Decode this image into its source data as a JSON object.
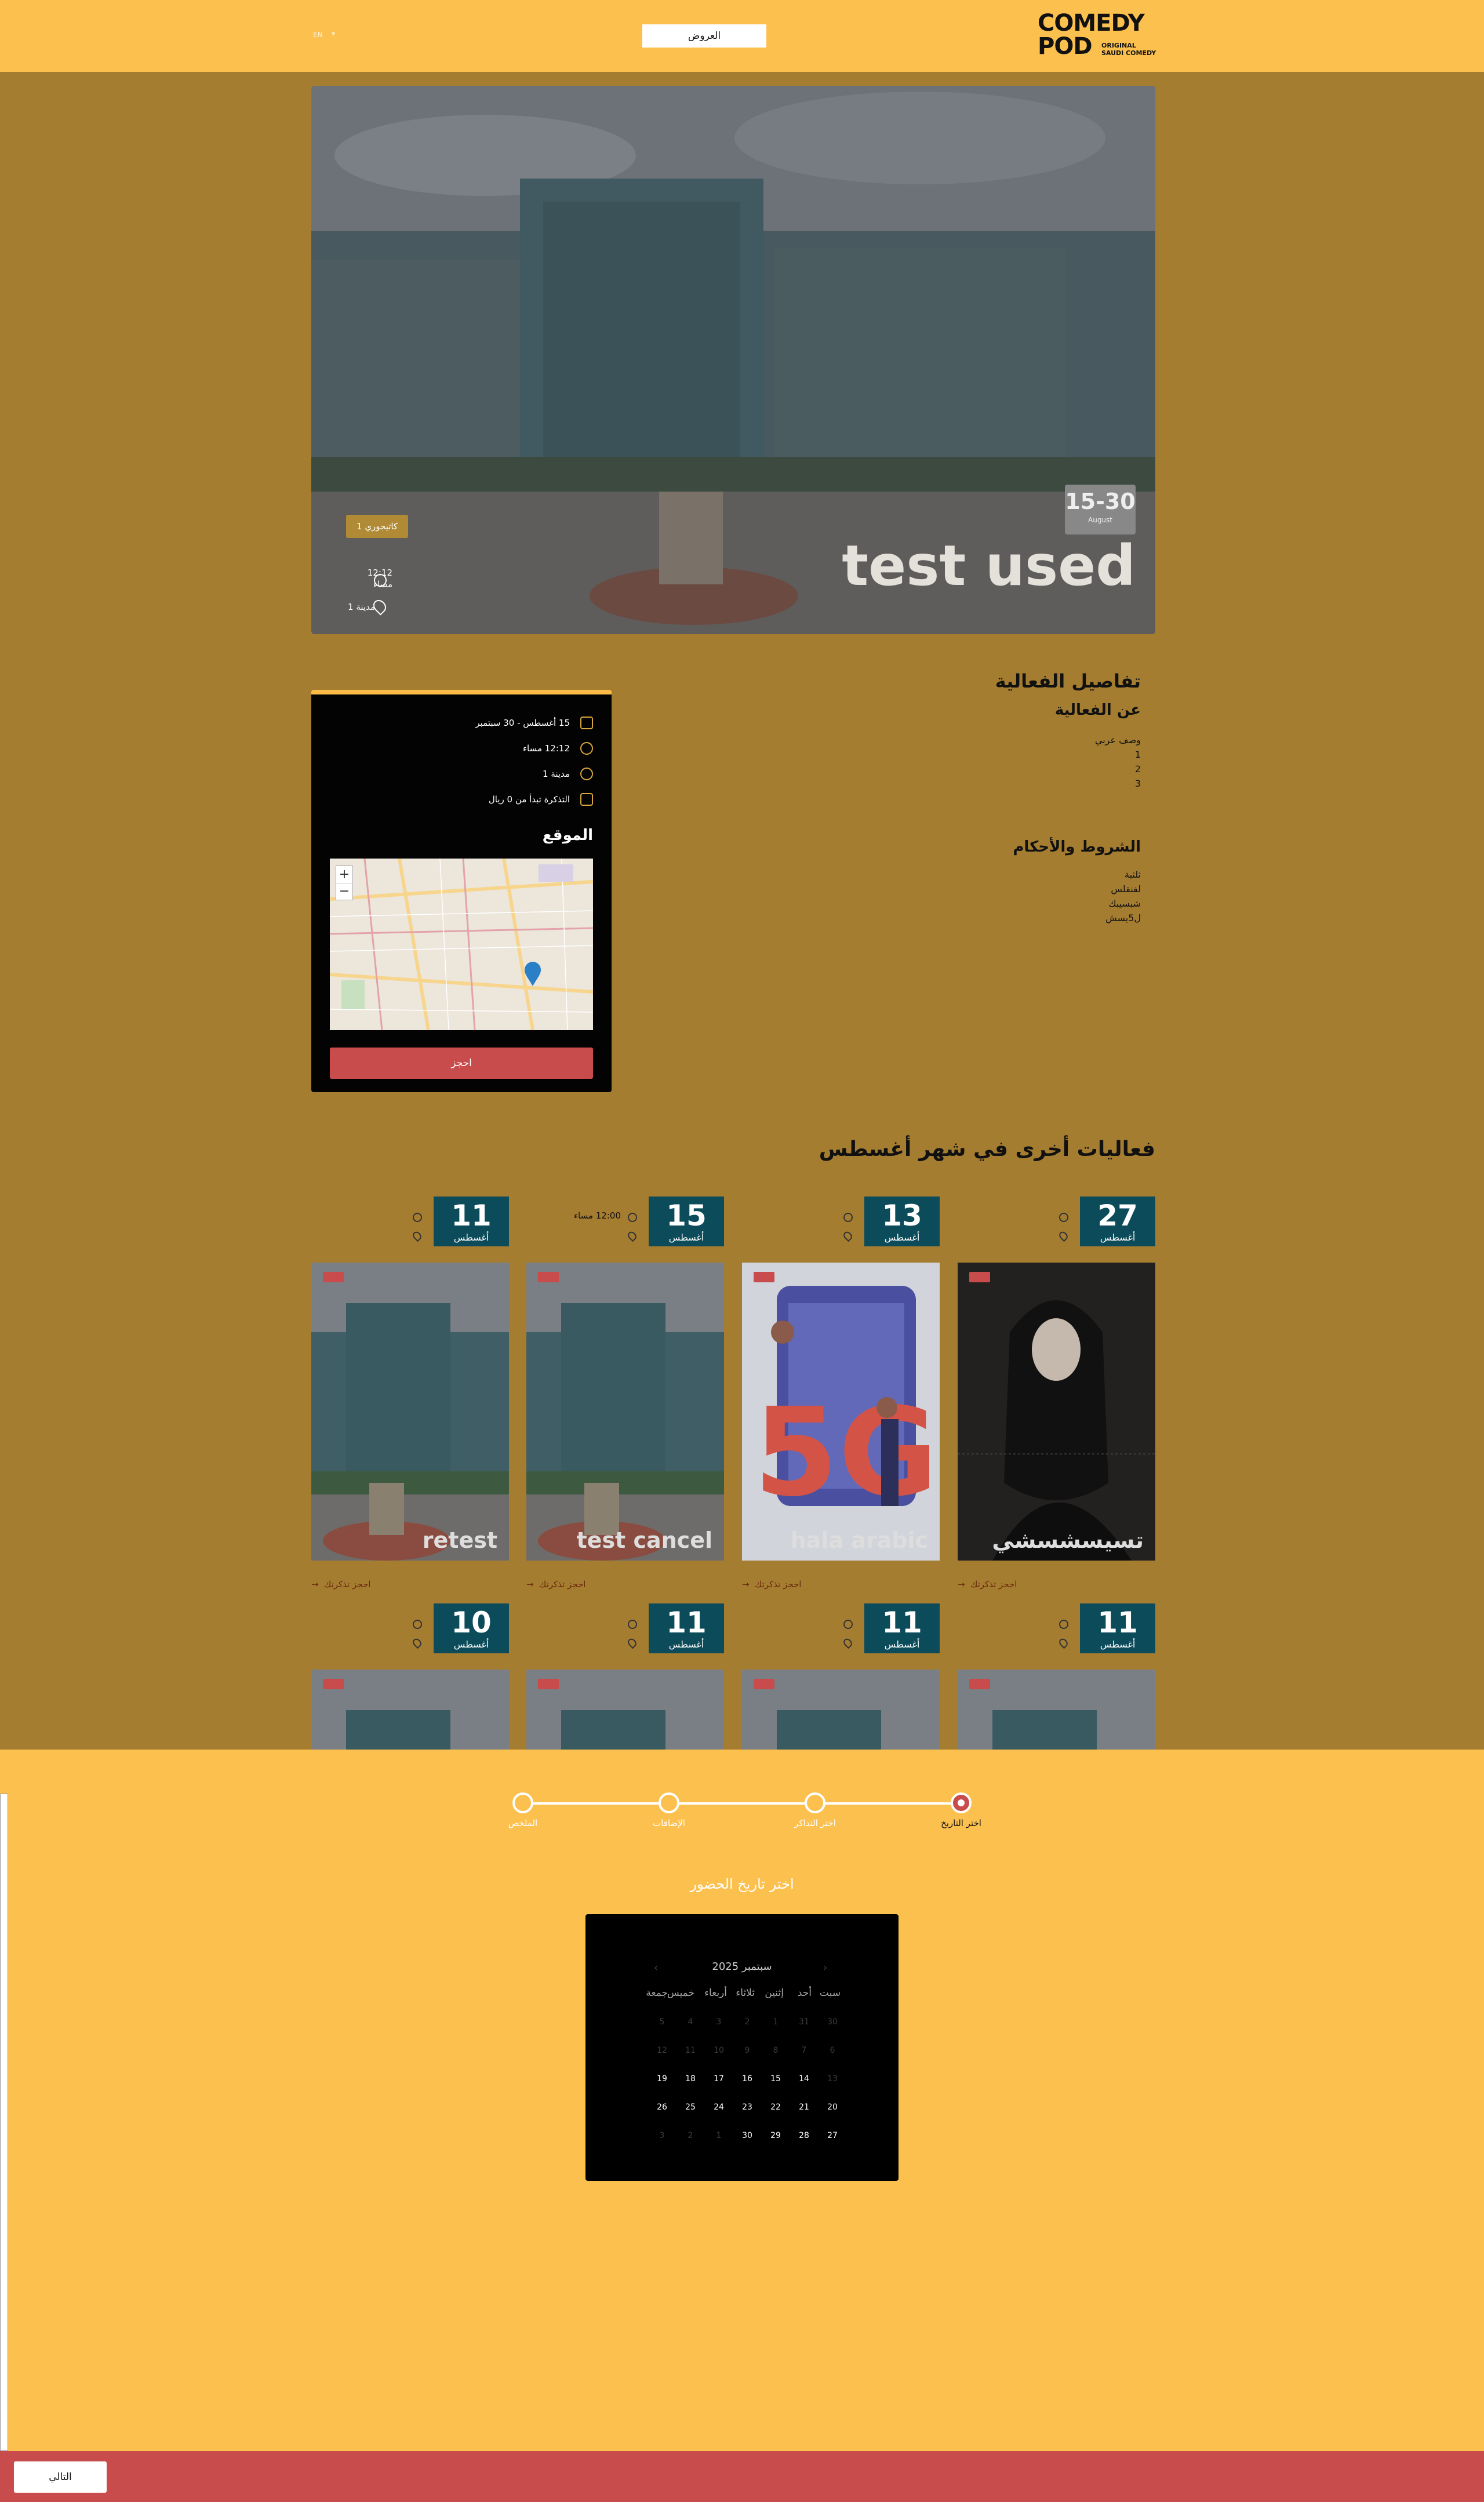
{
  "header": {
    "logo_main": "COMEDY\nPOD",
    "logo_sub": "ORIGINAL\nSAUDI COMEDY",
    "nav_button": "العروض",
    "lang": "EN"
  },
  "hero": {
    "title": "test used",
    "date_range": "15-30",
    "date_month": "August",
    "category": "كاتيجوري 1",
    "time": "12:12",
    "time_suffix": "مساء",
    "city": "مدينة 1"
  },
  "details": {
    "title": "تفاصيل الفعالية",
    "about_title": "عن الفعالية",
    "about_lines": [
      "وصف عربي",
      "1",
      "2",
      "3"
    ],
    "terms_title": "الشروط والأحكام",
    "terms_lines": [
      "ثلثبة",
      "لفنقلس",
      "شبسيبك",
      "ل5يسش"
    ]
  },
  "booking_card": {
    "date": "15 أغسطس - 30 سبتمبر",
    "time": "12:12 مساء",
    "city": "مدينة 1",
    "price": "التذكرة تبدأ من 0 ريال",
    "location_title": "الموقع",
    "zoom_in": "+",
    "zoom_out": "−",
    "book_button": "احجز"
  },
  "other_events": {
    "title": "فعاليات أخرى في شهر أغسطس",
    "items": [
      {
        "day": "27",
        "month": "أغسطس",
        "time": "",
        "name": "تسيسشسشي",
        "link": "احجز تذكرتك"
      },
      {
        "day": "13",
        "month": "أغسطس",
        "time": "",
        "name": "hala arabic",
        "link": "احجز تذكرتك"
      },
      {
        "day": "15",
        "month": "أغسطس",
        "time": "12:00 مساء",
        "name": "test cancel",
        "link": "احجز تذكرتك"
      },
      {
        "day": "11",
        "month": "أغسطس",
        "time": "",
        "name": "retest",
        "link": "احجز تذكرتك"
      },
      {
        "day": "11",
        "month": "أغسطس",
        "time": "",
        "name": "",
        "link": ""
      },
      {
        "day": "11",
        "month": "أغسطس",
        "time": "",
        "name": "",
        "link": ""
      },
      {
        "day": "11",
        "month": "أغسطس",
        "time": "",
        "name": "",
        "link": ""
      },
      {
        "day": "10",
        "month": "أغسطس",
        "time": "",
        "name": "",
        "link": ""
      }
    ]
  },
  "stepper": {
    "steps": [
      "اختر التاريخ",
      "اختر التذاكر",
      "الإضافات",
      "الملخص"
    ],
    "active_step": 0
  },
  "calendar": {
    "title": "اختر تاريخ الحضور",
    "month_label": "سبتمبر 2025",
    "prev": "‹",
    "next": "›",
    "weekdays": [
      "سبت",
      "أحد",
      "إثنين",
      "ثلاثاء",
      "أربعاء",
      "خميس",
      "جمعة"
    ],
    "weeks": [
      [
        "30",
        "31",
        "1",
        "2",
        "3",
        "4",
        "5"
      ],
      [
        "6",
        "7",
        "8",
        "9",
        "10",
        "11",
        "12"
      ],
      [
        "13",
        "14",
        "15",
        "16",
        "17",
        "18",
        "19"
      ],
      [
        "20",
        "21",
        "22",
        "23",
        "24",
        "25",
        "26"
      ],
      [
        "27",
        "28",
        "29",
        "30",
        "1",
        "2",
        "3"
      ]
    ],
    "enabled": [
      [
        false,
        false,
        false,
        false,
        false,
        false,
        false
      ],
      [
        false,
        false,
        false,
        false,
        false,
        false,
        false
      ],
      [
        false,
        true,
        true,
        true,
        true,
        true,
        true
      ],
      [
        true,
        true,
        true,
        true,
        true,
        true,
        true
      ],
      [
        true,
        true,
        true,
        true,
        false,
        false,
        false
      ]
    ]
  },
  "footer": {
    "next_button": "التالي"
  },
  "colors": {
    "brand_yellow": "#fcc04e",
    "dim_overlay": "#a57d31",
    "accent_red": "#c84c4c",
    "date_teal": "#0c4b5a"
  }
}
